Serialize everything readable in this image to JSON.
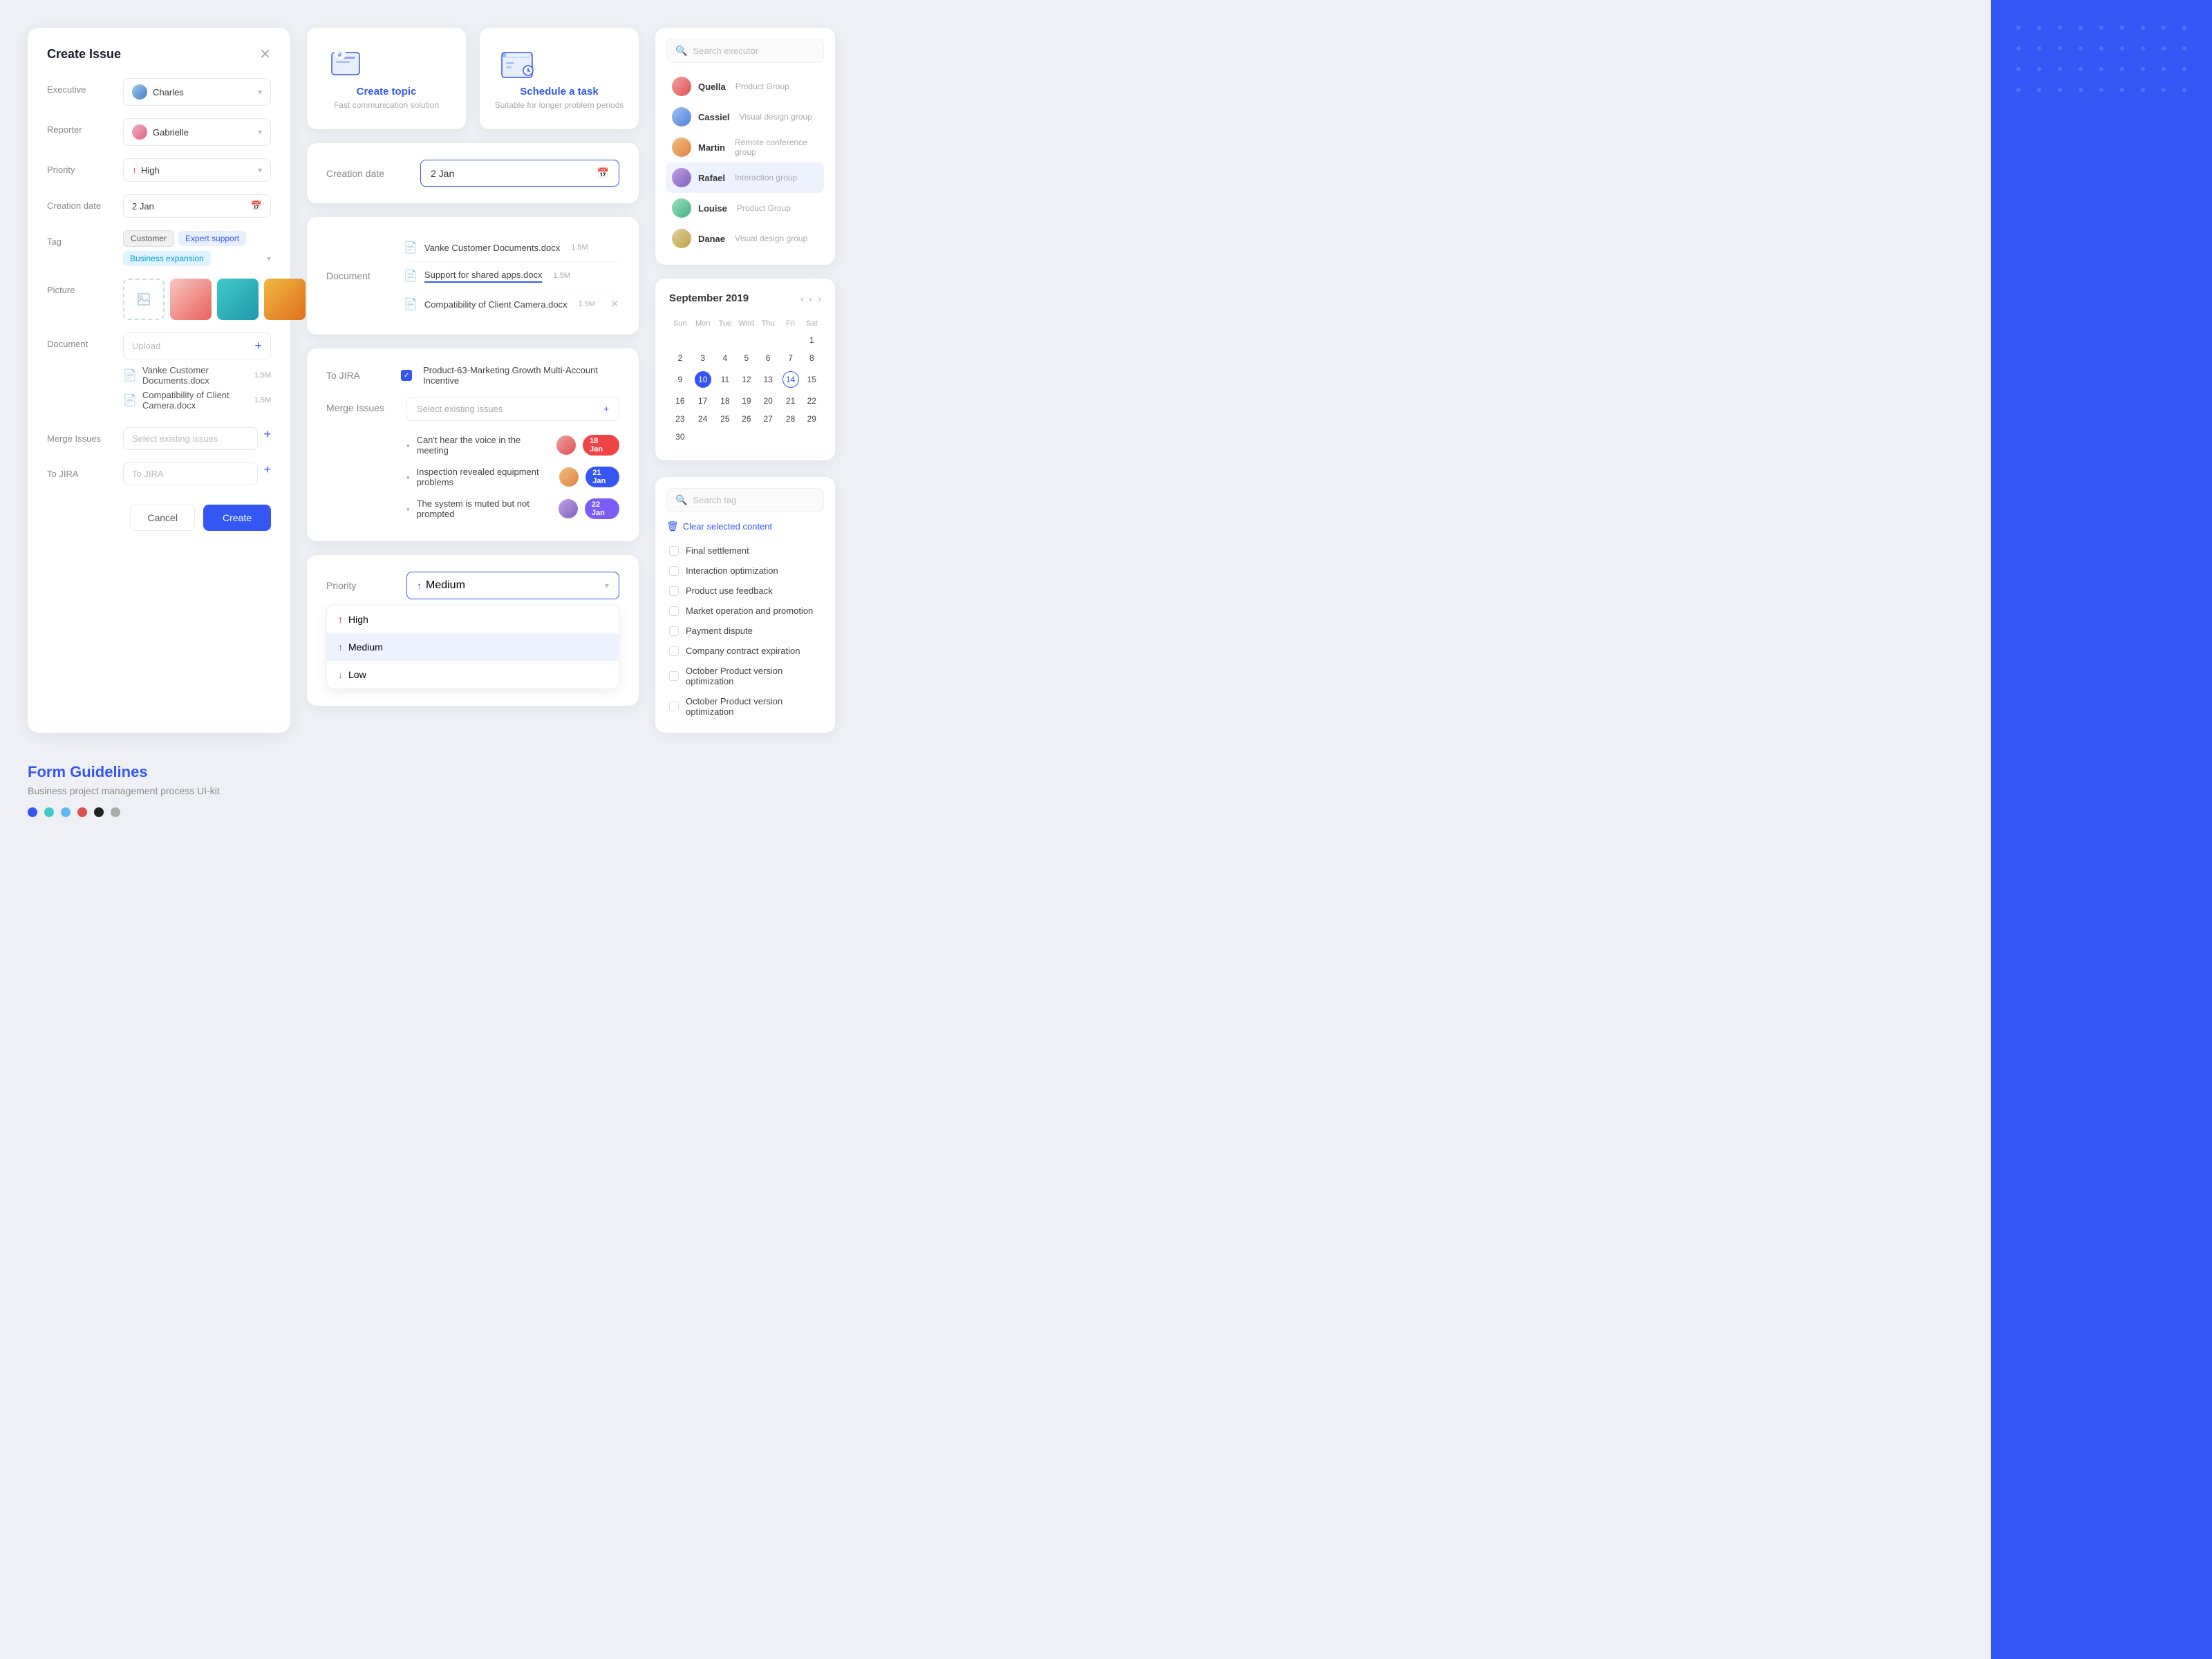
{
  "app": {
    "bg_accent_color": "#3356f5"
  },
  "create_issue": {
    "title": "Create Issue",
    "fields": {
      "executive": {
        "label": "Executive",
        "value": "Charles",
        "avatar_class": "av-charles"
      },
      "reporter": {
        "label": "Reporter",
        "value": "Gabrielle",
        "avatar_class": "av-gabrielle"
      },
      "priority": {
        "label": "Priority",
        "value": "High"
      },
      "creation_date": {
        "label": "Creation date",
        "value": "2 Jan"
      },
      "tag": {
        "label": "Tag",
        "tags": [
          "Customer",
          "Expert support",
          "Business expansion"
        ]
      },
      "picture": {
        "label": "Picture"
      },
      "document": {
        "label": "Document",
        "upload_label": "Upload",
        "files": [
          {
            "name": "Vanke Customer Documents.docx",
            "size": "1.5M"
          },
          {
            "name": "Compatibility of Client Camera.docx",
            "size": "1.5M"
          }
        ]
      },
      "merge_issues": {
        "label": "Merge Issues",
        "placeholder": "Select existing issues"
      },
      "to_jira": {
        "label": "To JIRA",
        "placeholder": "To JIRA"
      }
    },
    "cancel_label": "Cancel",
    "create_label": "Create"
  },
  "type_cards": [
    {
      "title": "Create topic",
      "subtitle": "Fast communication solution",
      "type": "topic"
    },
    {
      "title": "Schedule a task",
      "subtitle": "Suitable for longer problem periods",
      "type": "schedule"
    }
  ],
  "creation_date_panel": {
    "label": "Creation date",
    "value": "2 Jan"
  },
  "document_panel": {
    "label": "Document",
    "files": [
      {
        "name": "Vanke Customer Documents.docx",
        "size": "1.5M"
      },
      {
        "name": "Support for shared apps.docx",
        "size": "1.5M"
      },
      {
        "name": "Compatibility of Client Camera.docx",
        "size": "1.5M"
      }
    ]
  },
  "jira_panel": {
    "jira_label": "To JIRA",
    "jira_value": "Product-63-Marketing Growth Multi-Account Incentive",
    "merge_label": "Merge Issues",
    "merge_placeholder": "Select existing issues",
    "issues": [
      {
        "text": "Can't hear the voice in the meeting",
        "date": "18 Jan",
        "badge": "badge-red"
      },
      {
        "text": "Inspection revealed equipment problems",
        "date": "21 Jan",
        "badge": "badge-blue"
      },
      {
        "text": "The system is muted but not prompted",
        "date": "22 Jan",
        "badge": "badge-purple"
      }
    ]
  },
  "priority_panel": {
    "label": "Priority",
    "selected": "Medium",
    "options": [
      {
        "label": "High",
        "direction": "up",
        "active": false
      },
      {
        "label": "Medium",
        "direction": "up",
        "active": true
      },
      {
        "label": "Low",
        "direction": "down",
        "active": false
      }
    ]
  },
  "executor_panel": {
    "search_placeholder": "Search executor",
    "executors": [
      {
        "name": "Quella",
        "group": "Product Group",
        "avatar_class": "av-quella",
        "active": false
      },
      {
        "name": "Cassiel",
        "group": "Visual design group",
        "avatar_class": "av-cassiel",
        "active": false
      },
      {
        "name": "Martin",
        "group": "Remote conference group",
        "avatar_class": "av-martin",
        "active": false
      },
      {
        "name": "Rafael",
        "group": "Interaction group",
        "avatar_class": "av-rafael",
        "active": true
      },
      {
        "name": "Louise",
        "group": "Product Group",
        "avatar_class": "av-louise",
        "active": false
      },
      {
        "name": "Danae",
        "group": "Visual design group",
        "avatar_class": "av-danae",
        "active": false
      }
    ]
  },
  "calendar": {
    "title": "September 2019",
    "weekdays": [
      "Sun",
      "Mon",
      "Tue",
      "Wed",
      "Thu",
      "Fri",
      "Sat"
    ],
    "weeks": [
      [
        null,
        null,
        null,
        null,
        null,
        null,
        "1"
      ],
      [
        "2",
        "3",
        "4",
        "5",
        "6",
        "7",
        "8"
      ],
      [
        "9",
        "10",
        "11",
        "12",
        "13",
        "14",
        "15"
      ],
      [
        "16",
        "17",
        "18",
        "19",
        "20",
        "21",
        "22"
      ],
      [
        "23",
        "24",
        "25",
        "26",
        "27",
        "28",
        "29"
      ],
      [
        "30",
        null,
        null,
        null,
        null,
        null,
        null
      ]
    ],
    "today": "10",
    "selected": "14"
  },
  "tag_panel": {
    "search_placeholder": "Search tag",
    "clear_label": "Clear selected content",
    "tags": [
      "Final settlement",
      "Interaction optimization",
      "Product use feedback",
      "Market operation and promotion",
      "Payment dispute",
      "Company contract expiration",
      "October Product version optimization",
      "October Product version optimization"
    ]
  },
  "form_guidelines": {
    "title": "Form Guidelines",
    "subtitle": "Business project management process UI-kit",
    "dots": [
      "#3356f5",
      "#40c9c9",
      "#60b8f0",
      "#e05050",
      "#222222",
      "#aaaaaa"
    ]
  }
}
